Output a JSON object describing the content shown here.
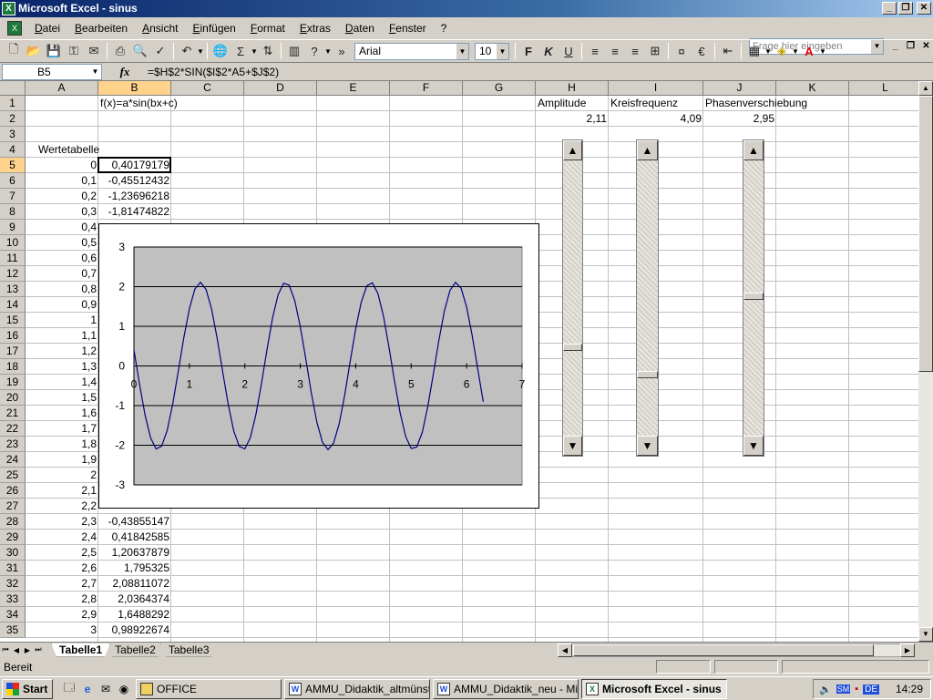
{
  "window": {
    "title": "Microsoft Excel - sinus",
    "app_icon": "excel-icon",
    "min": "_",
    "max": "❐",
    "close": "✕"
  },
  "menubar": {
    "items": [
      "Datei",
      "Bearbeiten",
      "Ansicht",
      "Einfügen",
      "Format",
      "Extras",
      "Daten",
      "Fenster",
      "?"
    ],
    "help_placeholder": "Frage hier eingeben"
  },
  "toolbar": {
    "font": "Arial",
    "size": "10",
    "bold": "F",
    "italic": "K",
    "underline": "U"
  },
  "formula_bar": {
    "name_box": "B5",
    "fx": "fx",
    "formula": "=$H$2*SIN($I$2*A5+$J$2)"
  },
  "sheet": {
    "columns": [
      "A",
      "B",
      "C",
      "D",
      "E",
      "F",
      "G",
      "H",
      "I",
      "J",
      "K",
      "L"
    ],
    "rows": [
      "1",
      "2",
      "3",
      "4",
      "5",
      "6",
      "7",
      "8",
      "9",
      "10",
      "11",
      "12",
      "13",
      "14",
      "15",
      "16",
      "17",
      "18",
      "19",
      "20",
      "21",
      "22",
      "23",
      "24",
      "25",
      "26",
      "27",
      "28",
      "29",
      "30",
      "31",
      "32",
      "33",
      "34",
      "35"
    ],
    "cells": {
      "B1": "f(x)=a*sin(bx+c)",
      "H1": "Amplitude",
      "I1": "Kreisfrequenz",
      "J1": "Phasenverschiebung",
      "H2": "2,11",
      "I2": "4,09",
      "J2": "2,95",
      "A4": "Wertetabelle"
    },
    "table": [
      [
        "0",
        "0,40179179"
      ],
      [
        "0,1",
        "-0,45512432"
      ],
      [
        "0,2",
        "-1,23696218"
      ],
      [
        "0,3",
        "-1,81474822"
      ],
      [
        "0,4",
        ""
      ],
      [
        "0,5",
        ""
      ],
      [
        "0,6",
        ""
      ],
      [
        "0,7",
        ""
      ],
      [
        "0,8",
        ""
      ],
      [
        "0,9",
        ""
      ],
      [
        "1",
        ""
      ],
      [
        "1,1",
        ""
      ],
      [
        "1,2",
        ""
      ],
      [
        "1,3",
        ""
      ],
      [
        "1,4",
        ""
      ],
      [
        "1,5",
        ""
      ],
      [
        "1,6",
        ""
      ],
      [
        "1,7",
        ""
      ],
      [
        "1,8",
        ""
      ],
      [
        "1,9",
        ""
      ],
      [
        "2",
        ""
      ],
      [
        "2,1",
        ""
      ],
      [
        "2,2",
        ""
      ],
      [
        "2,3",
        "-0,43855147"
      ],
      [
        "2,4",
        "0,41842585"
      ],
      [
        "2,5",
        "1,20637879"
      ],
      [
        "2,6",
        "1,795325"
      ],
      [
        "2,7",
        "2,08811072"
      ],
      [
        "2,8",
        "2,0364374"
      ],
      [
        "2,9",
        "1,6488292"
      ],
      [
        "3",
        "0,98922674"
      ]
    ]
  },
  "sheet_tabs": [
    "Tabelle1",
    "Tabelle2",
    "Tabelle3"
  ],
  "status": "Bereit",
  "taskbar": {
    "start": "Start",
    "buttons": [
      "OFFICE",
      "AMMU_Didaktik_altmünst...",
      "AMMU_Didaktik_neu - Mic...",
      "Microsoft Excel - sinus"
    ],
    "tray_lang": "DE",
    "clock": "14:29"
  },
  "chart_data": {
    "type": "line",
    "title": "",
    "xlabel": "",
    "ylabel": "",
    "xlim": [
      0,
      7
    ],
    "ylim": [
      -3,
      3
    ],
    "xticks": [
      "0",
      "1",
      "2",
      "3",
      "4",
      "5",
      "6",
      "7"
    ],
    "yticks": [
      "3",
      "2",
      "1",
      "0",
      "-1",
      "-2",
      "-3"
    ],
    "series": [
      {
        "formula_params": {
          "a": 2.11,
          "b": 4.09,
          "c": 2.95
        },
        "x_start": 0,
        "x_end": 6.3,
        "x_step": 0.1,
        "color": "#000080"
      }
    ],
    "plot_bg": "#c0c0c0",
    "grid": "horizontal"
  },
  "scrollbar_controls": [
    {
      "label": "Amplitude",
      "value_fraction": 0.68
    },
    {
      "label": "Kreisfrequenz",
      "value_fraction": 0.78
    },
    {
      "label": "Phasenverschiebung",
      "value_fraction": 0.49
    }
  ]
}
